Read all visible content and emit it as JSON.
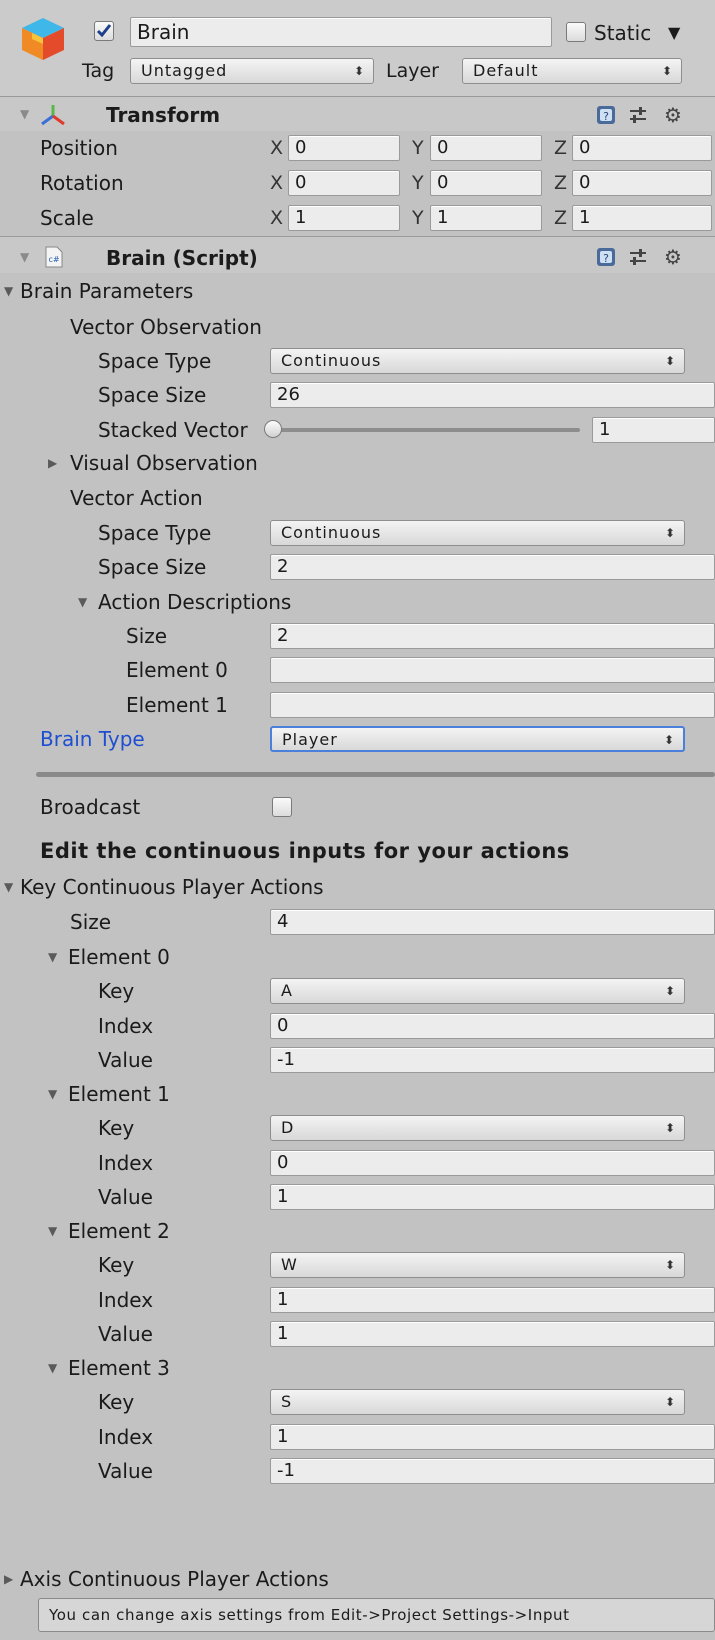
{
  "object": {
    "enabled": true,
    "name": "Brain",
    "static_label": "Static",
    "static_checked": false,
    "tag_label": "Tag",
    "tag_value": "Untagged",
    "layer_label": "Layer",
    "layer_value": "Default"
  },
  "transform": {
    "title": "Transform",
    "rows": [
      {
        "label": "Position",
        "x": "0",
        "y": "0",
        "z": "0"
      },
      {
        "label": "Rotation",
        "x": "0",
        "y": "0",
        "z": "0"
      },
      {
        "label": "Scale",
        "x": "1",
        "y": "1",
        "z": "1"
      }
    ],
    "axis_labels": {
      "x": "X",
      "y": "Y",
      "z": "Z"
    }
  },
  "script": {
    "title": "Brain (Script)",
    "icon_text": "c#",
    "brain_parameters": "Brain Parameters",
    "vector_observation": {
      "label": "Vector Observation",
      "space_type_label": "Space Type",
      "space_type_value": "Continuous",
      "space_size_label": "Space Size",
      "space_size_value": "26",
      "stacked_label": "Stacked Vector",
      "stacked_value": "1",
      "stacked_fraction": 0.0
    },
    "visual_observation": "Visual Observation",
    "vector_action": {
      "label": "Vector Action",
      "space_type_label": "Space Type",
      "space_type_value": "Continuous",
      "space_size_label": "Space Size",
      "space_size_value": "2",
      "descriptions_label": "Action Descriptions",
      "size_label": "Size",
      "size_value": "2",
      "elements": [
        {
          "label": "Element 0",
          "value": ""
        },
        {
          "label": "Element 1",
          "value": ""
        }
      ]
    },
    "brain_type_label": "Brain Type",
    "brain_type_value": "Player",
    "broadcast_label": "Broadcast",
    "broadcast_checked": false,
    "heading": "Edit the continuous inputs for your actions",
    "key_actions": {
      "label": "Key Continuous Player Actions",
      "size_label": "Size",
      "size_value": "4",
      "field_labels": {
        "key": "Key",
        "index": "Index",
        "value": "Value"
      },
      "elements": [
        {
          "label": "Element 0",
          "key": "A",
          "index": "0",
          "value": "-1"
        },
        {
          "label": "Element 1",
          "key": "D",
          "index": "0",
          "value": "1"
        },
        {
          "label": "Element 2",
          "key": "W",
          "index": "1",
          "value": "1"
        },
        {
          "label": "Element 3",
          "key": "S",
          "index": "1",
          "value": "-1"
        }
      ]
    },
    "axis_actions": "Axis Continuous Player Actions",
    "help": "You can change axis settings from Edit->Project Settings->Input"
  },
  "colors": {
    "background": "#c2c2c2",
    "brain_type_label": "#1f4fd1",
    "field_bg": "#ececec"
  }
}
